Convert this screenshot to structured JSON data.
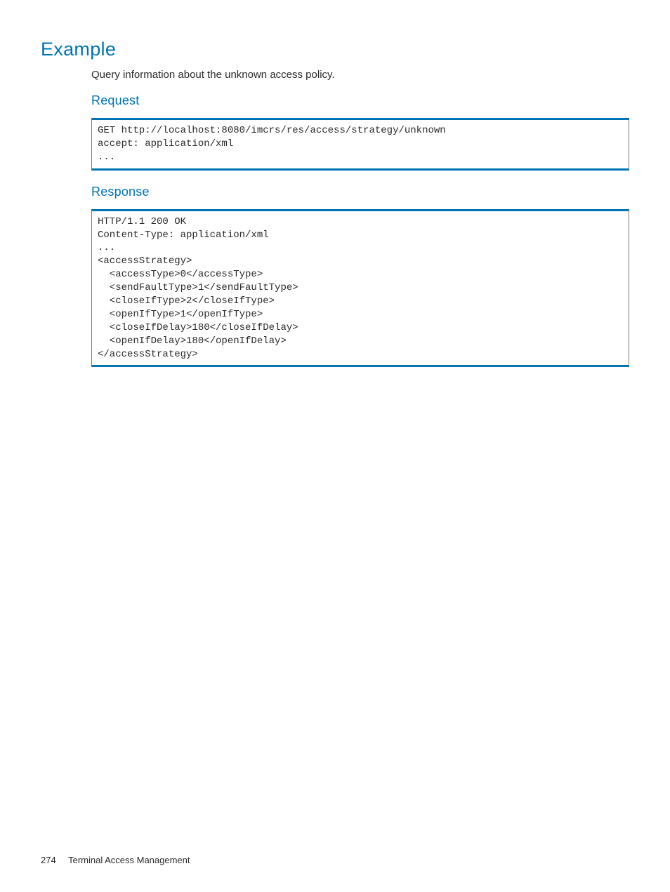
{
  "heading_main": "Example",
  "intro_text": "Query information about the unknown access policy.",
  "heading_request": "Request",
  "code_request": "GET http://localhost:8080/imcrs/res/access/strategy/unknown\naccept: application/xml\n...",
  "heading_response": "Response",
  "code_response": "HTTP/1.1 200 OK\nContent-Type: application/xml\n...\n<accessStrategy>\n  <accessType>0</accessType>\n  <sendFaultType>1</sendFaultType>\n  <closeIfType>2</closeIfType>\n  <openIfType>1</openIfType>\n  <closeIfDelay>180</closeIfDelay>\n  <openIfDelay>180</openIfDelay>\n</accessStrategy>",
  "footer": {
    "page_number": "274",
    "section_title": "Terminal Access Management"
  }
}
